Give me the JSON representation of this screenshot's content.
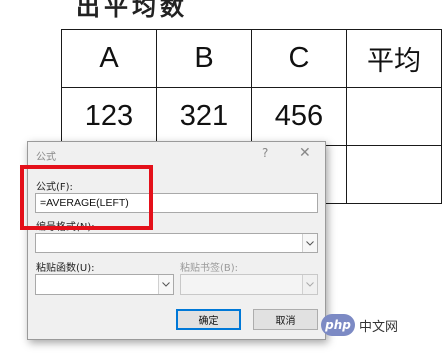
{
  "heading_fragment": "出平均数",
  "table": {
    "rows": [
      [
        "A",
        "B",
        "C",
        "平均"
      ],
      [
        "123",
        "321",
        "456",
        ""
      ],
      [
        "",
        "",
        "",
        ""
      ]
    ]
  },
  "dialog": {
    "title": "公式",
    "help": "?",
    "close": "✕",
    "formula_label": "公式(F):",
    "formula_value": "=AVERAGE(LEFT)",
    "number_format_label": "编号格式(N):",
    "number_format_value": "",
    "paste_function_label": "粘贴函数(U):",
    "paste_bookmark_label": "粘贴书签(B):",
    "ok_label": "确定",
    "cancel_label": "取消"
  },
  "highlight_color": "#e4101a",
  "watermark": {
    "logo": "php",
    "text": "中文网"
  }
}
